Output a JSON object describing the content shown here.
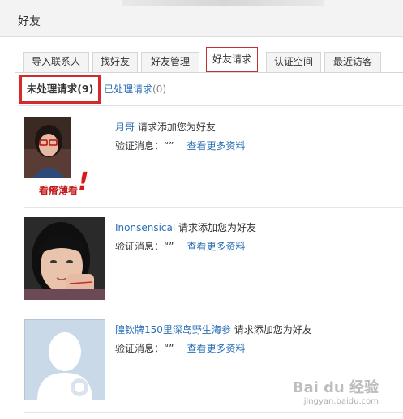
{
  "header": {
    "title": "好友"
  },
  "tabs": [
    {
      "label": "导入联系人"
    },
    {
      "label": "找好友"
    },
    {
      "label": "好友管理"
    },
    {
      "label": "好友请求"
    },
    {
      "label": "认证空间"
    },
    {
      "label": "最近访客"
    }
  ],
  "active_tab": "好友请求",
  "subtabs": {
    "pending": "未处理请求(9)",
    "processed_prefix": "已处理请求",
    "processed_count": "(0)"
  },
  "requests": [
    {
      "name": "月哥",
      "action": "请求添加您为好友",
      "verify_label": "验证消息：“”",
      "more": "查看更多资料",
      "annotation": "看瘠薄看"
    },
    {
      "name": "Inonsensical",
      "action": "请求添加您为好友",
      "verify_label": "验证消息：“”",
      "more": "查看更多资料"
    },
    {
      "name": "隍钦牌150里深岛野生海参",
      "action": "请求添加您为好友",
      "verify_label": "验证消息：“”",
      "more": "查看更多资料"
    }
  ],
  "watermark": {
    "logo": "Bai du 经验",
    "url": "jingyan.baidu.com"
  },
  "colors": {
    "accent_red": "#c62f2f",
    "link_blue": "#2a6fb6"
  }
}
